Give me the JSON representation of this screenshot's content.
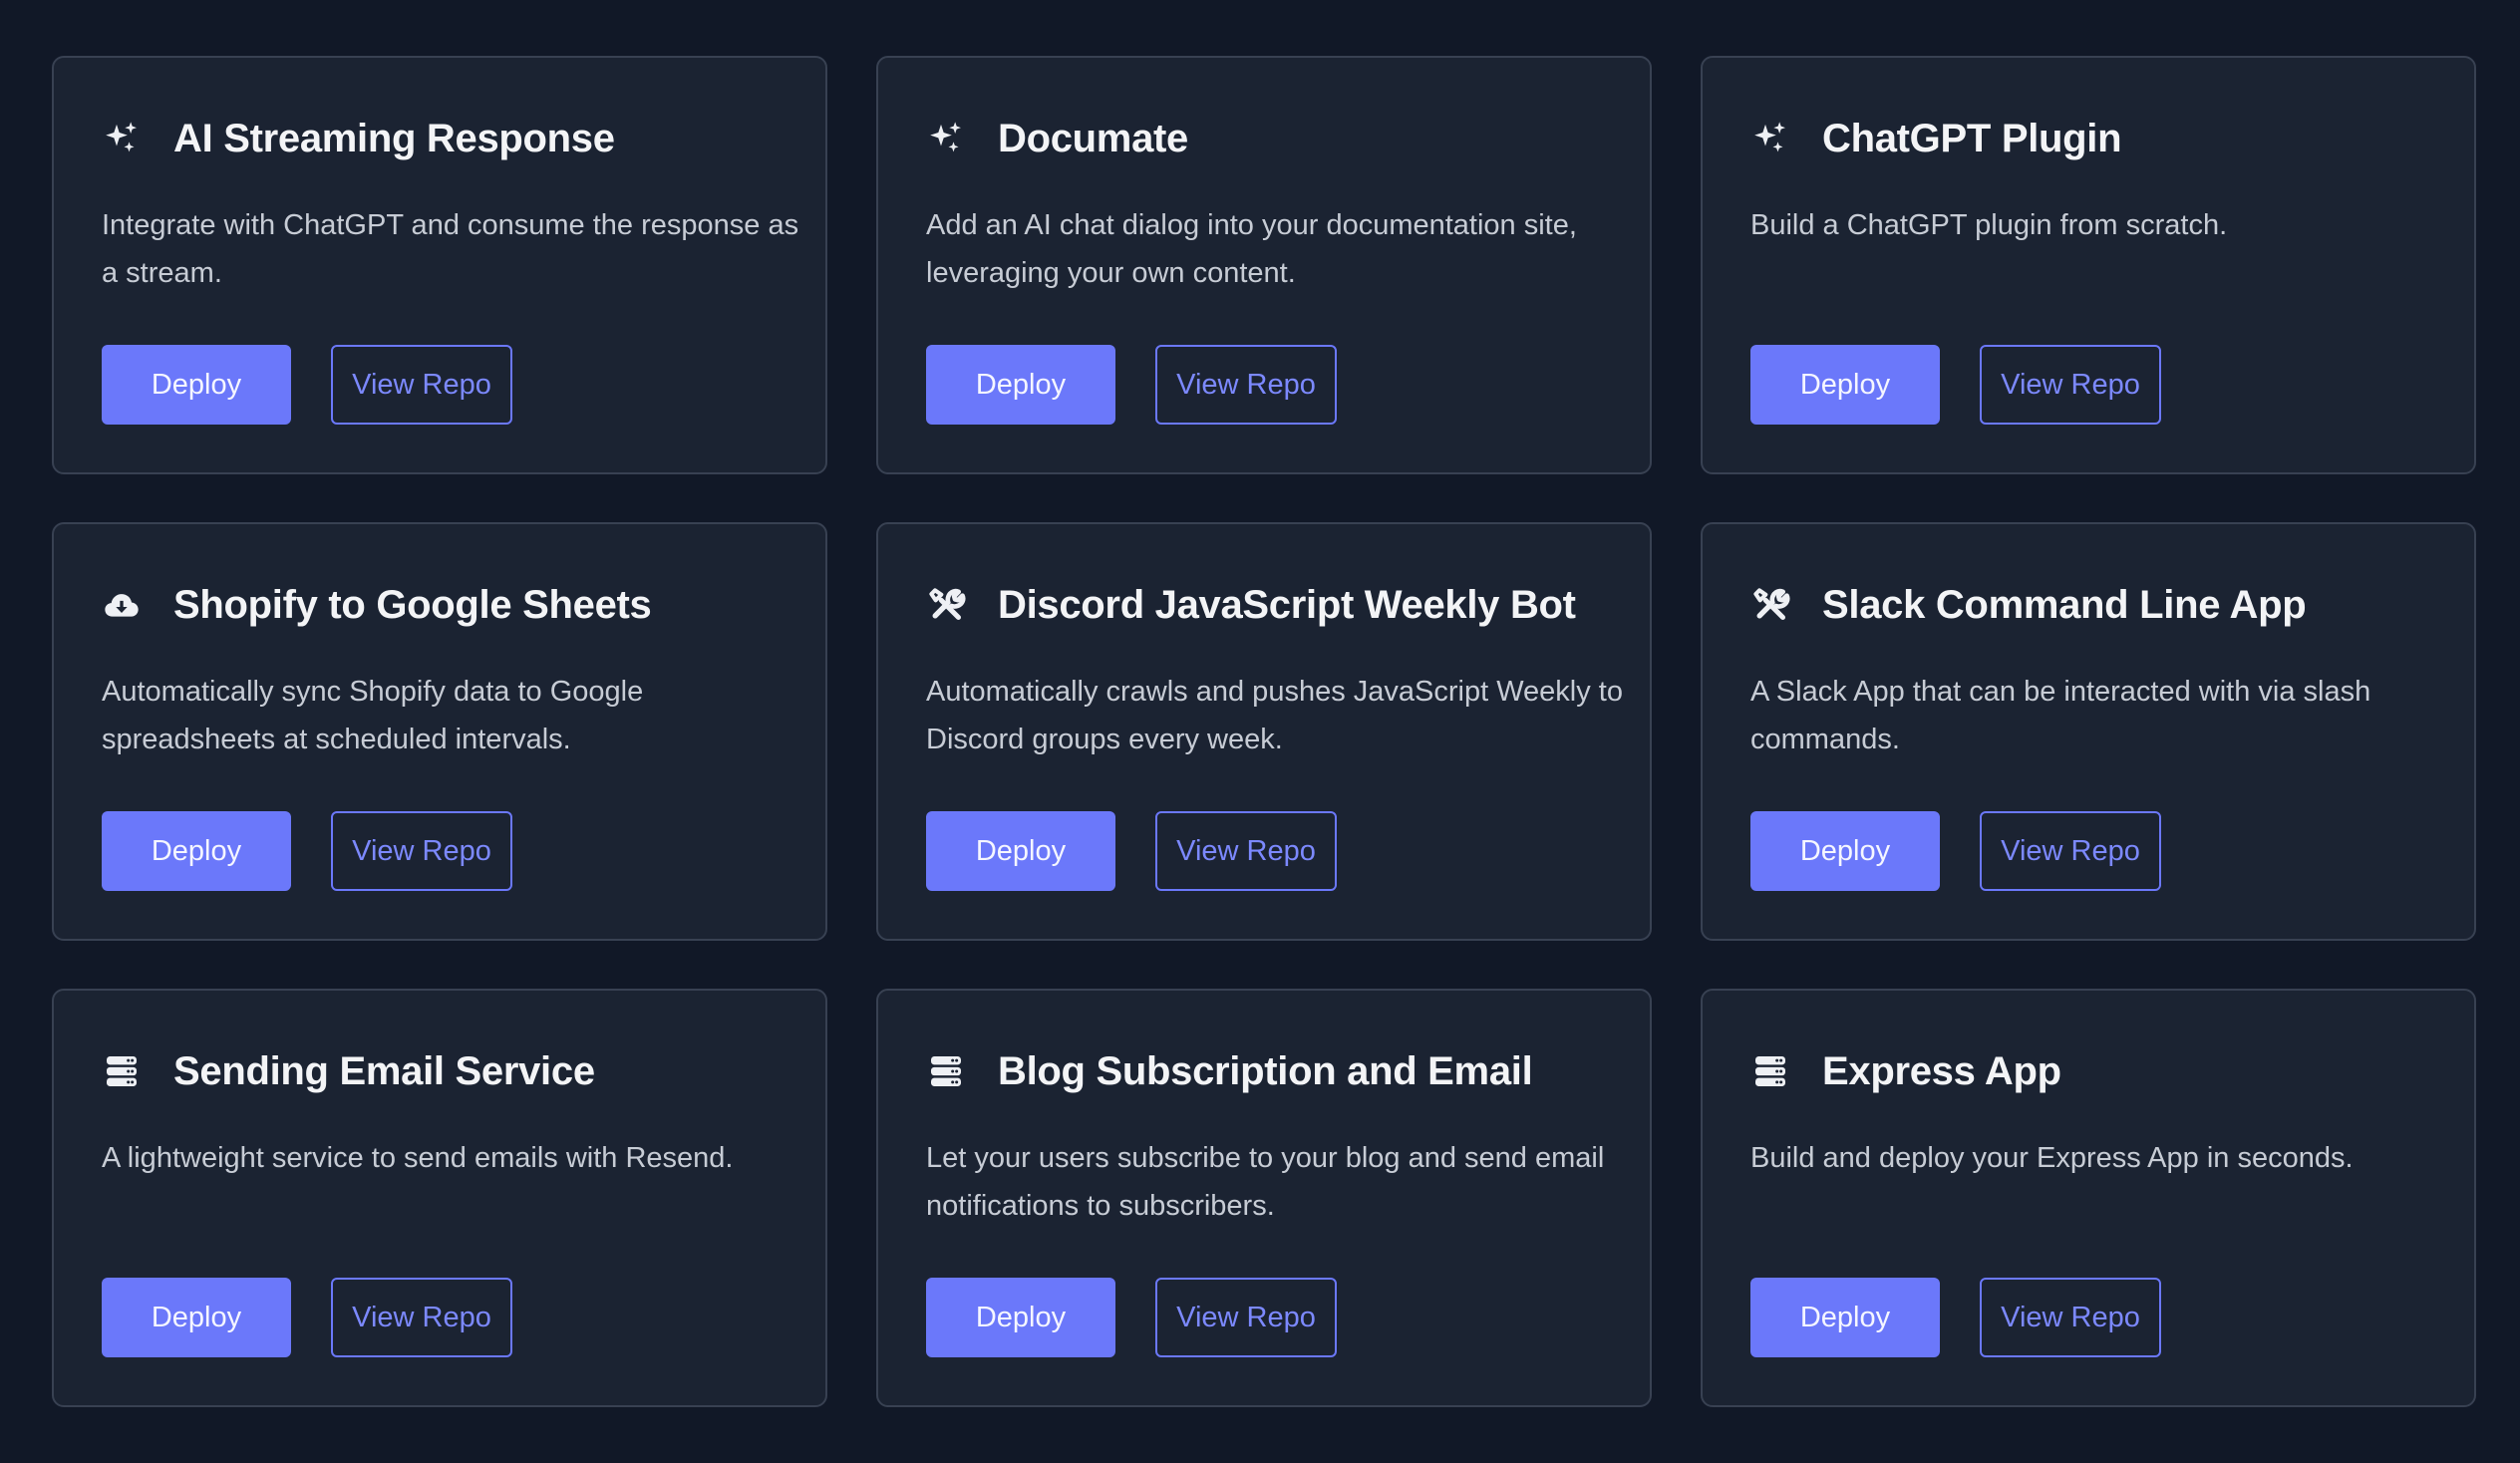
{
  "cards": [
    {
      "icon": "sparkles-icon",
      "title": "AI Streaming Response",
      "description": "Integrate with ChatGPT and consume the response as a stream.",
      "deploy_label": "Deploy",
      "repo_label": "View Repo"
    },
    {
      "icon": "sparkles-icon",
      "title": "Documate",
      "description": "Add an AI chat dialog into your documentation site, leveraging your own content.",
      "deploy_label": "Deploy",
      "repo_label": "View Repo"
    },
    {
      "icon": "sparkles-icon",
      "title": "ChatGPT Plugin",
      "description": "Build a ChatGPT plugin from scratch.",
      "deploy_label": "Deploy",
      "repo_label": "View Repo"
    },
    {
      "icon": "cloud-download-icon",
      "title": "Shopify to Google Sheets",
      "description": "Automatically sync Shopify data to Google spreadsheets at scheduled intervals.",
      "deploy_label": "Deploy",
      "repo_label": "View Repo"
    },
    {
      "icon": "wrench-screwdriver-icon",
      "title": "Discord JavaScript Weekly Bot",
      "description": "Automatically crawls and pushes JavaScript Weekly to Discord groups every week.",
      "deploy_label": "Deploy",
      "repo_label": "View Repo"
    },
    {
      "icon": "wrench-screwdriver-icon",
      "title": "Slack Command Line App",
      "description": "A Slack App that can be interacted with via slash commands.",
      "deploy_label": "Deploy",
      "repo_label": "View Repo"
    },
    {
      "icon": "server-stack-icon",
      "title": "Sending Email Service",
      "description": "A lightweight service to send emails with Resend.",
      "deploy_label": "Deploy",
      "repo_label": "View Repo"
    },
    {
      "icon": "server-stack-icon",
      "title": "Blog Subscription and Email",
      "description": "Let your users subscribe to your blog and send email notifications to subscribers.",
      "deploy_label": "Deploy",
      "repo_label": "View Repo"
    },
    {
      "icon": "server-stack-icon",
      "title": "Express App",
      "description": "Build and deploy your Express App in seconds.",
      "deploy_label": "Deploy",
      "repo_label": "View Repo"
    }
  ],
  "colors": {
    "background": "#111827",
    "card": "#1b2332",
    "card_border": "#384152",
    "accent": "#6b78fa",
    "title": "#f3f4f6",
    "description": "#c7ccd5"
  }
}
